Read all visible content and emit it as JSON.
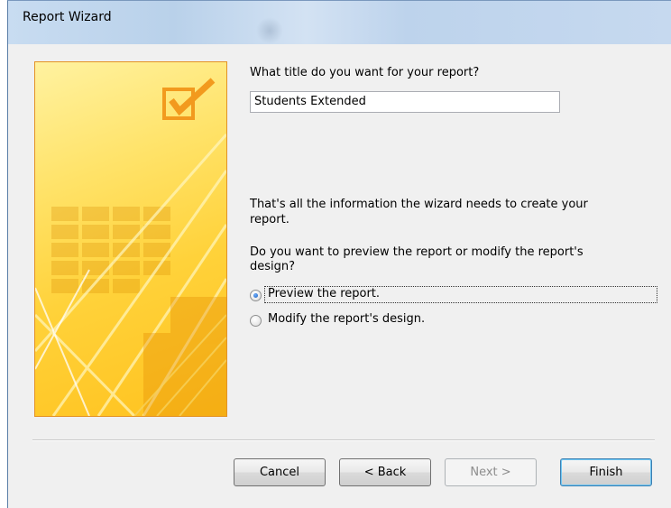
{
  "window": {
    "title": "Report Wizard"
  },
  "main": {
    "title_prompt": "What title do you want for your report?",
    "report_title_value": "Students Extended",
    "info_line1": "That's all the information the wizard needs to create your",
    "info_line2": "report.",
    "preview_question_line1": "Do you want to preview the report or modify the report's",
    "preview_question_line2": "design?",
    "options": [
      {
        "label": "Preview the report.",
        "selected": true
      },
      {
        "label": "Modify the report's design.",
        "selected": false
      }
    ]
  },
  "buttons": {
    "cancel": "Cancel",
    "back": "< Back",
    "next": "Next >",
    "finish": "Finish"
  },
  "colors": {
    "banner_border": "#e39224",
    "banner_yellow": "#ffd23a",
    "checkbox_orange": "#f29a1e",
    "default_button_accent": "#3c7fb1"
  },
  "icons": {
    "banner_icon": "checkmark-box-icon"
  }
}
